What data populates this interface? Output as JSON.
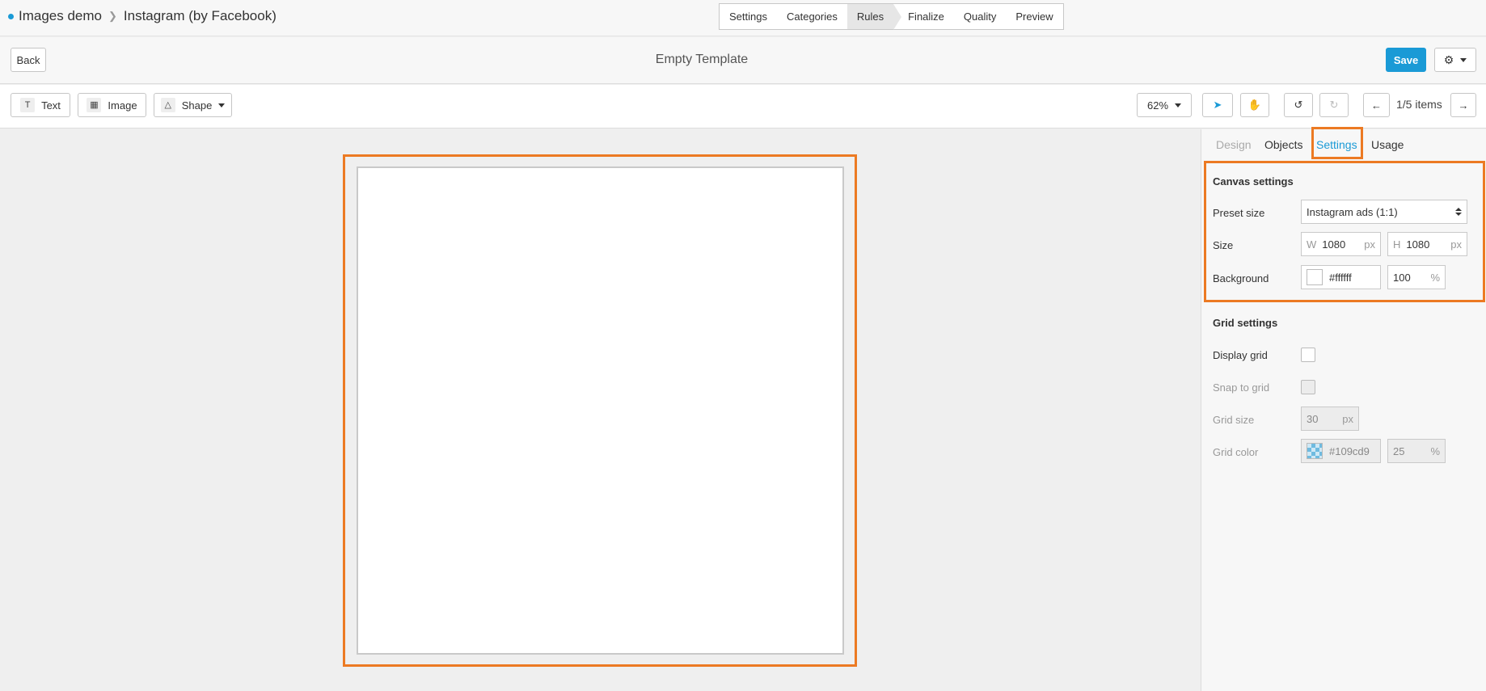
{
  "breadcrumb": {
    "project": "Images demo",
    "page": "Instagram (by Facebook)"
  },
  "steps": [
    "Settings",
    "Categories",
    "Rules",
    "Finalize",
    "Quality",
    "Preview"
  ],
  "active_step": "Rules",
  "titlebar": {
    "back_label": "Back",
    "title": "Empty Template",
    "save_label": "Save"
  },
  "toolbar": {
    "text_label": "Text",
    "image_label": "Image",
    "shape_label": "Shape",
    "zoom": "62%",
    "items": "1/5 items"
  },
  "panel": {
    "tabs": [
      "Design",
      "Objects",
      "Settings",
      "Usage"
    ],
    "active_tab": "Settings",
    "canvas": {
      "title": "Canvas settings",
      "preset_label": "Preset size",
      "preset_value": "Instagram ads (1:1)",
      "size_label": "Size",
      "w_prefix": "W",
      "width": "1080",
      "h_prefix": "H",
      "height": "1080",
      "unit": "px",
      "bg_label": "Background",
      "bg_color": "#ffffff",
      "bg_opacity": "100",
      "pct": "%"
    },
    "grid": {
      "title": "Grid settings",
      "display_label": "Display grid",
      "snap_label": "Snap to grid",
      "size_label": "Grid size",
      "size_value": "30",
      "unit": "px",
      "color_label": "Grid color",
      "color_value": "#109cd9",
      "opacity": "25",
      "pct": "%"
    }
  },
  "colors": {
    "accent": "#1a9ad6",
    "highlight": "#ec7a23"
  }
}
